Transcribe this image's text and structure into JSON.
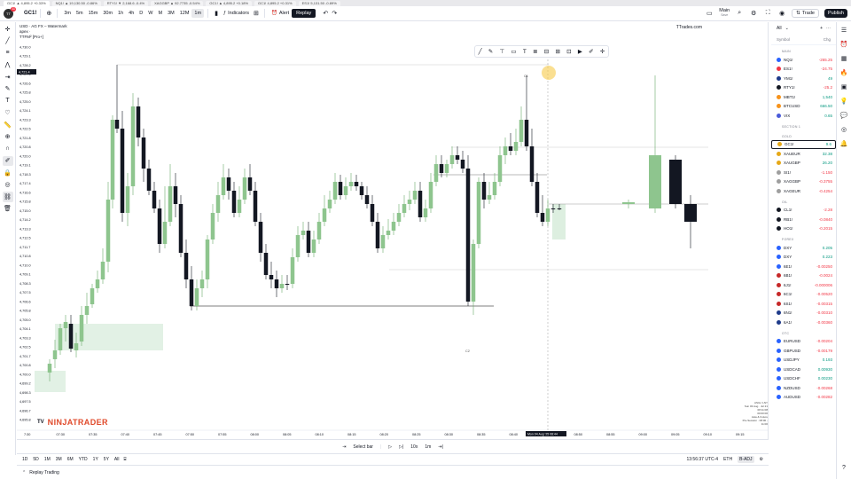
{
  "browser_tabs": [
    {
      "label": "GC1! ▲ 4,895.2 +0.33%"
    },
    {
      "label": "NQ1! ▲ 19,130.50 -0.86%"
    },
    {
      "label": "RTY1! ▼ 2,168.6 -0.4%"
    },
    {
      "label": "XAGGBP ▲ 92.7735 -0.54%"
    },
    {
      "label": "GC1! ▲ 4,895.2 +0.18%"
    },
    {
      "label": "GC1! 4,895.2 +0.31%"
    },
    {
      "label": "ES1! 5,131.50 -0.89%"
    }
  ],
  "toolbar": {
    "avatar_initials": "TT",
    "avatar_badge": "11",
    "symbol": "GC1!",
    "intervals": [
      "3m",
      "5m",
      "15m",
      "30m",
      "1h",
      "4h",
      "D",
      "W",
      "M",
      "3M",
      "12M",
      "1m"
    ],
    "active_interval": "1m",
    "indicators_label": "Indicators",
    "alert_label": "Alert",
    "replay_label": "Replay",
    "layout_name": "Main",
    "layout_sub": "Save",
    "trade_label": "Trade",
    "publish_label": "Publish"
  },
  "chart": {
    "legend_line1": "USD · AG FX – Watermark",
    "legend_line2": "apex ·",
    "legend_line3": "TTFM² [Pro+]",
    "brand": "TTrades.com",
    "crosshair_price": "4,721.4",
    "watermark_brand": "NINJATRADER",
    "watermark_tv": "TV",
    "annotation_c1": "C1",
    "annotation_c2": "C2",
    "price_labels": [
      "4,730.0",
      "4,729.1",
      "4,728.2",
      "4,727.4",
      "4,726.6",
      "4,725.8",
      "4,725.0",
      "4,724.1",
      "4,723.3",
      "4,722.5",
      "4,721.8",
      "4,720.8",
      "4,720.0",
      "4,719.1",
      "4,718.3",
      "4,717.4",
      "4,716.6",
      "4,715.8",
      "4,715.0",
      "4,714.2",
      "4,713.3",
      "4,712.5",
      "4,711.7",
      "4,710.8",
      "4,710.0",
      "4,709.1",
      "4,708.3",
      "4,707.5",
      "4,706.6",
      "4,705.8",
      "4,705.0",
      "4,704.1",
      "4,703.3",
      "4,702.5",
      "4,701.7",
      "4,700.8",
      "4,700.0",
      "4,699.2",
      "4,698.3",
      "4,697.5",
      "4,696.7",
      "4,695.8"
    ],
    "time_labels": [
      "7:30",
      "07:30",
      "07:35",
      "07:40",
      "07:45",
      "07:50",
      "07:55",
      "08:00",
      "08:05",
      "08:10",
      "08:15",
      "08:20",
      "08:25",
      "08:30",
      "08:35",
      "08:40",
      "08:45",
      "08:50",
      "08:55",
      "09:00",
      "09:05",
      "09:10",
      "09:15"
    ],
    "crosshair_time": "Mon 04 Aug '25 08:44",
    "info_lines": [
      "ASIA / LNY",
      "Sun 03 Aug · Jul 21",
      "08:11:08",
      "00:00:00",
      "Asia & Future",
      "Pre-Session · 08:00 - 11:00"
    ]
  },
  "bottom": {
    "select_bar": "Select bar",
    "speed": "10x",
    "interval": "1m",
    "ranges": [
      "1D",
      "5D",
      "1M",
      "3M",
      "6M",
      "YTD",
      "1Y",
      "5Y",
      "All"
    ],
    "clock": "13:56:37 UTC-4",
    "session": "ETH",
    "adj": "B-ADJ",
    "footer_label": "Replay Trading"
  },
  "watchlist": {
    "title": "All",
    "col_symbol": "Symbol",
    "col_chg": "Chg",
    "sections": [
      {
        "name": "MAIN",
        "items": [
          {
            "sym": "NQ1!",
            "chg": "-265.25",
            "color": "#2962ff",
            "neg": true
          },
          {
            "sym": "ES1!",
            "chg": "-24.75",
            "color": "#f23645",
            "neg": true
          },
          {
            "sym": "YM1!",
            "chg": "49",
            "color": "#1e3a8a",
            "neg": false
          },
          {
            "sym": "RTY1!",
            "chg": "-25.2",
            "color": "#131722",
            "neg": true
          },
          {
            "sym": "MBT1!",
            "chg": "1,540",
            "color": "#f7931a",
            "neg": false
          },
          {
            "sym": "BTCUSD",
            "chg": "666.50",
            "color": "#f7931a",
            "neg": false
          },
          {
            "sym": "VIX",
            "chg": "0.65",
            "color": "#4a5bd9",
            "neg": false
          }
        ]
      },
      {
        "name": "SECTION 1",
        "items": []
      },
      {
        "name": "GOLD",
        "items": [
          {
            "sym": "GC1!",
            "chg": "9.6",
            "color": "#e6a817",
            "neg": false,
            "sel": true
          },
          {
            "sym": "XAUEUR",
            "chg": "32.38",
            "color": "#e6a817",
            "neg": false
          },
          {
            "sym": "XAUGBP",
            "chg": "26.20",
            "color": "#e6a817",
            "neg": false
          },
          {
            "sym": "SI1!",
            "chg": "-1.150",
            "color": "#9e9e9e",
            "neg": true
          },
          {
            "sym": "XAGGBP",
            "chg": "-0.3755",
            "color": "#9e9e9e",
            "neg": true
          },
          {
            "sym": "XAGEUR",
            "chg": "-0.4254",
            "color": "#9e9e9e",
            "neg": true
          }
        ]
      },
      {
        "name": "OIL",
        "items": [
          {
            "sym": "CL1!",
            "chg": "-2.28",
            "color": "#131722",
            "neg": true
          },
          {
            "sym": "RB1!",
            "chg": "-0.0840",
            "color": "#131722",
            "neg": true
          },
          {
            "sym": "HO1!",
            "chg": "-0.2015",
            "color": "#131722",
            "neg": true
          }
        ]
      },
      {
        "name": "FOREX",
        "items": [
          {
            "sym": "DXY",
            "chg": "0.205",
            "color": "#2962ff",
            "neg": false
          },
          {
            "sym": "DXY",
            "chg": "0.223",
            "color": "#2962ff",
            "neg": false
          },
          {
            "sym": "6E1!",
            "chg": "-0.00250",
            "color": "#2962ff",
            "neg": true
          },
          {
            "sym": "6B1!",
            "chg": "-0.0024",
            "color": "#c62828",
            "neg": true
          },
          {
            "sym": "6J1!",
            "chg": "-0.000006",
            "color": "#c62828",
            "neg": true
          },
          {
            "sym": "6C1!",
            "chg": "-0.00520",
            "color": "#c62828",
            "neg": true
          },
          {
            "sym": "6S1!",
            "chg": "-0.00315",
            "color": "#c62828",
            "neg": true
          },
          {
            "sym": "6N1!",
            "chg": "-0.00310",
            "color": "#1e3a8a",
            "neg": true
          },
          {
            "sym": "6A1!",
            "chg": "-0.00360",
            "color": "#1e3a8a",
            "neg": true
          }
        ]
      },
      {
        "name": "OTC",
        "items": [
          {
            "sym": "EURUSD",
            "chg": "-0.00204",
            "color": "#2962ff",
            "neg": true
          },
          {
            "sym": "GBPUSD",
            "chg": "-0.00179",
            "color": "#2962ff",
            "neg": true
          },
          {
            "sym": "USDJPY",
            "chg": "0.193",
            "color": "#2962ff",
            "neg": false
          },
          {
            "sym": "USDCAD",
            "chg": "0.00930",
            "color": "#2962ff",
            "neg": false
          },
          {
            "sym": "USDCHF",
            "chg": "0.00230",
            "color": "#2962ff",
            "neg": false
          },
          {
            "sym": "NZDUSD",
            "chg": "-0.00268",
            "color": "#2962ff",
            "neg": true
          },
          {
            "sym": "AUDUSD",
            "chg": "-0.00282",
            "color": "#2962ff",
            "neg": true
          }
        ]
      }
    ]
  }
}
